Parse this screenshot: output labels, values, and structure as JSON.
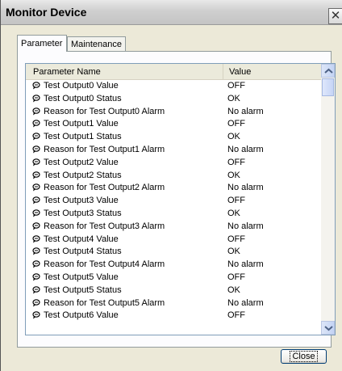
{
  "window": {
    "title": "Monitor Device"
  },
  "tabs": [
    {
      "label": "Parameter",
      "active": true
    },
    {
      "label": "Maintenance",
      "active": false
    }
  ],
  "table": {
    "columns": [
      "Parameter Name",
      "Value"
    ],
    "rows": [
      {
        "name": "Test Output0 Value",
        "value": "OFF"
      },
      {
        "name": "Test Output0 Status",
        "value": "OK"
      },
      {
        "name": "Reason for Test Output0 Alarm",
        "value": "No alarm"
      },
      {
        "name": "Test Output1 Value",
        "value": "OFF"
      },
      {
        "name": "Test Output1 Status",
        "value": "OK"
      },
      {
        "name": "Reason for Test Output1 Alarm",
        "value": "No alarm"
      },
      {
        "name": "Test Output2 Value",
        "value": "OFF"
      },
      {
        "name": "Test Output2 Status",
        "value": "OK"
      },
      {
        "name": "Reason for Test Output2 Alarm",
        "value": "No alarm"
      },
      {
        "name": "Test Output3 Value",
        "value": "OFF"
      },
      {
        "name": "Test Output3 Status",
        "value": "OK"
      },
      {
        "name": "Reason for Test Output3 Alarm",
        "value": "No alarm"
      },
      {
        "name": "Test Output4 Value",
        "value": "OFF"
      },
      {
        "name": "Test Output4 Status",
        "value": "OK"
      },
      {
        "name": "Reason for Test Output4 Alarm",
        "value": "No alarm"
      },
      {
        "name": "Test Output5 Value",
        "value": "OFF"
      },
      {
        "name": "Test Output5 Status",
        "value": "OK"
      },
      {
        "name": "Reason for Test Output5 Alarm",
        "value": "No alarm"
      },
      {
        "name": "Test Output6 Value",
        "value": "OFF"
      }
    ],
    "row_icon": "parameter-icon"
  },
  "buttons": {
    "close_label": "Close"
  },
  "colors": {
    "list_border": "#7f9db9",
    "panel_bg": "#ece9d8"
  }
}
